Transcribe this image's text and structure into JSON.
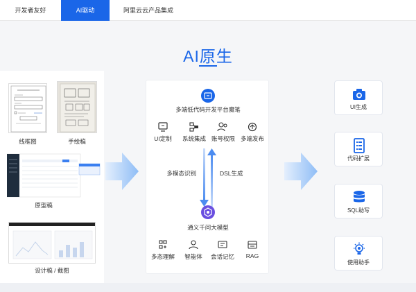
{
  "tabs": [
    {
      "label": "开发者友好"
    },
    {
      "label": "AI驱动"
    },
    {
      "label": "阿里云云产品集成"
    }
  ],
  "page_title": "AI原生",
  "inputs": {
    "wireframe_label": "线框图",
    "sketch_label": "手绘稿",
    "prototype_label": "原型稿",
    "design_label": "设计稿 / 截图"
  },
  "platform": {
    "title": "多端低代码开发平台魔笔",
    "features": [
      "UI定制",
      "系统集成",
      "账号权限",
      "多端发布"
    ],
    "flow_down": "多模态识别",
    "flow_up": "DSL生成"
  },
  "model": {
    "title": "通义千问大模型",
    "features": [
      "多态理解",
      "智能体",
      "会话记忆",
      "RAG"
    ]
  },
  "outputs": [
    {
      "label": "UI生成",
      "icon": "camera-icon"
    },
    {
      "label": "代码扩展",
      "icon": "code-list-icon"
    },
    {
      "label": "SQL助写",
      "icon": "database-icon"
    },
    {
      "label": "使用助手",
      "icon": "lightbulb-icon"
    }
  ],
  "colors": {
    "accent": "#1a66e8",
    "arrow": "#9cc4f7"
  }
}
